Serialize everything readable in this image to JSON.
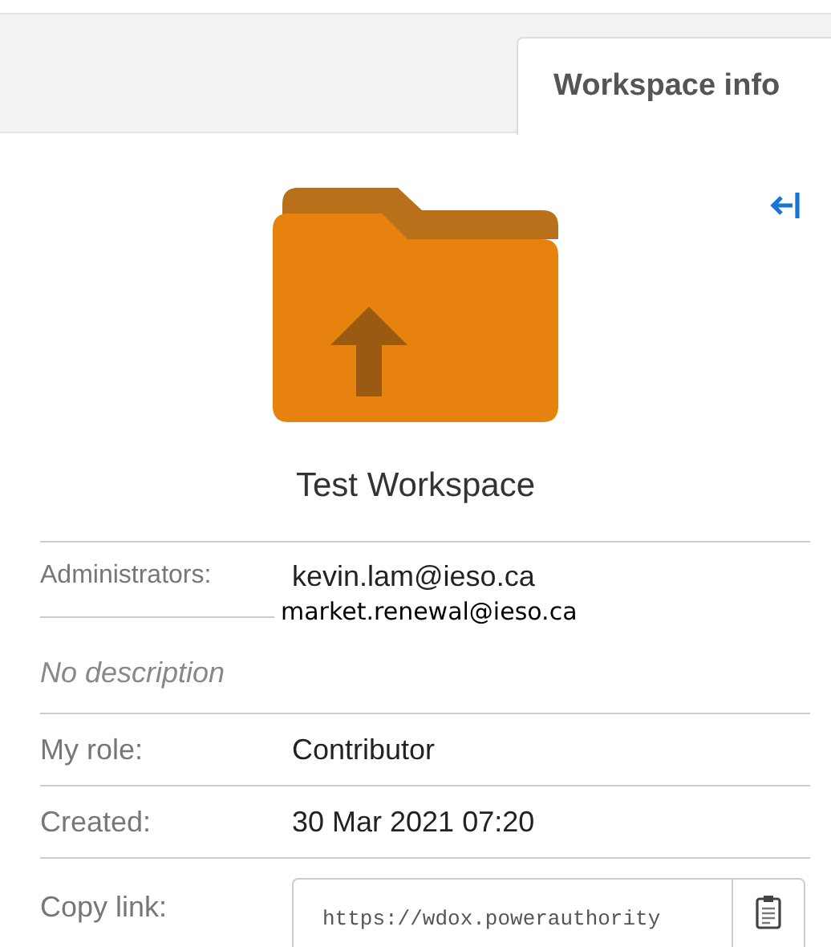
{
  "tabs": [
    {
      "label": "Workspace info",
      "selected": true
    }
  ],
  "workspace": {
    "name": "Test Workspace"
  },
  "administrators": {
    "label": "Administrators:",
    "values": [
      "kevin.lam@ieso.ca",
      "market.renewal@ieso.ca"
    ]
  },
  "description": "No description",
  "details": [
    {
      "label": "My role:",
      "value": "Contributor"
    },
    {
      "label": "Created:",
      "value": "30 Mar 2021 07:20"
    }
  ],
  "copy_link": {
    "label": "Copy link:",
    "value": "https://wdox.powerauthority"
  }
}
